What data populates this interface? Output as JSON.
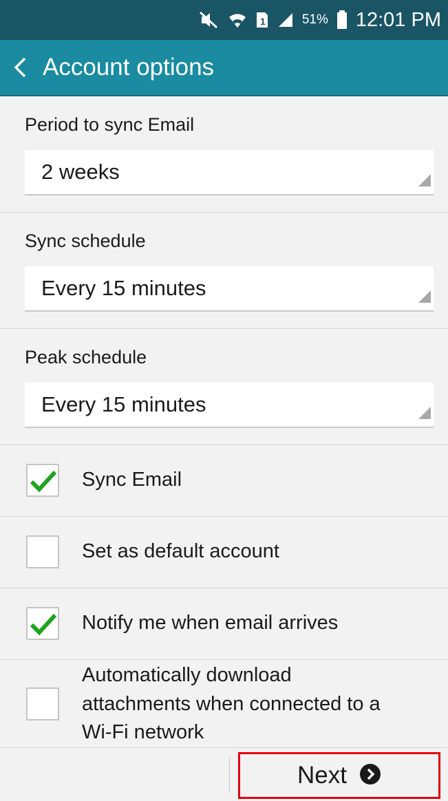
{
  "status_bar": {
    "icons": [
      "mute-icon",
      "wifi-icon",
      "sim-icon",
      "signal-icon",
      "battery-icon"
    ],
    "battery_percent": "51%",
    "time": "12:01 PM"
  },
  "app_bar": {
    "back_icon": "chevron-left-icon",
    "title": "Account options",
    "color": "#1a8ba0"
  },
  "settings": {
    "period_to_sync": {
      "label": "Period to sync Email",
      "value": "2 weeks"
    },
    "sync_schedule": {
      "label": "Sync schedule",
      "value": "Every 15 minutes"
    },
    "peak_schedule": {
      "label": "Peak schedule",
      "value": "Every 15 minutes"
    }
  },
  "options": {
    "sync_email": {
      "label": "Sync Email",
      "checked": true
    },
    "default_account": {
      "label": "Set as default account",
      "checked": false
    },
    "notify": {
      "label": "Notify me when email arrives",
      "checked": true
    },
    "auto_download": {
      "label_line1": "Automatically download",
      "label_line2": "attachments when connected to a",
      "label_line3": "Wi-Fi network",
      "checked": false
    }
  },
  "footer": {
    "next_label": "Next",
    "next_icon": "chevron-right-circle-icon"
  },
  "colors": {
    "check": "#1fa31f",
    "highlight": "#e3000f"
  }
}
